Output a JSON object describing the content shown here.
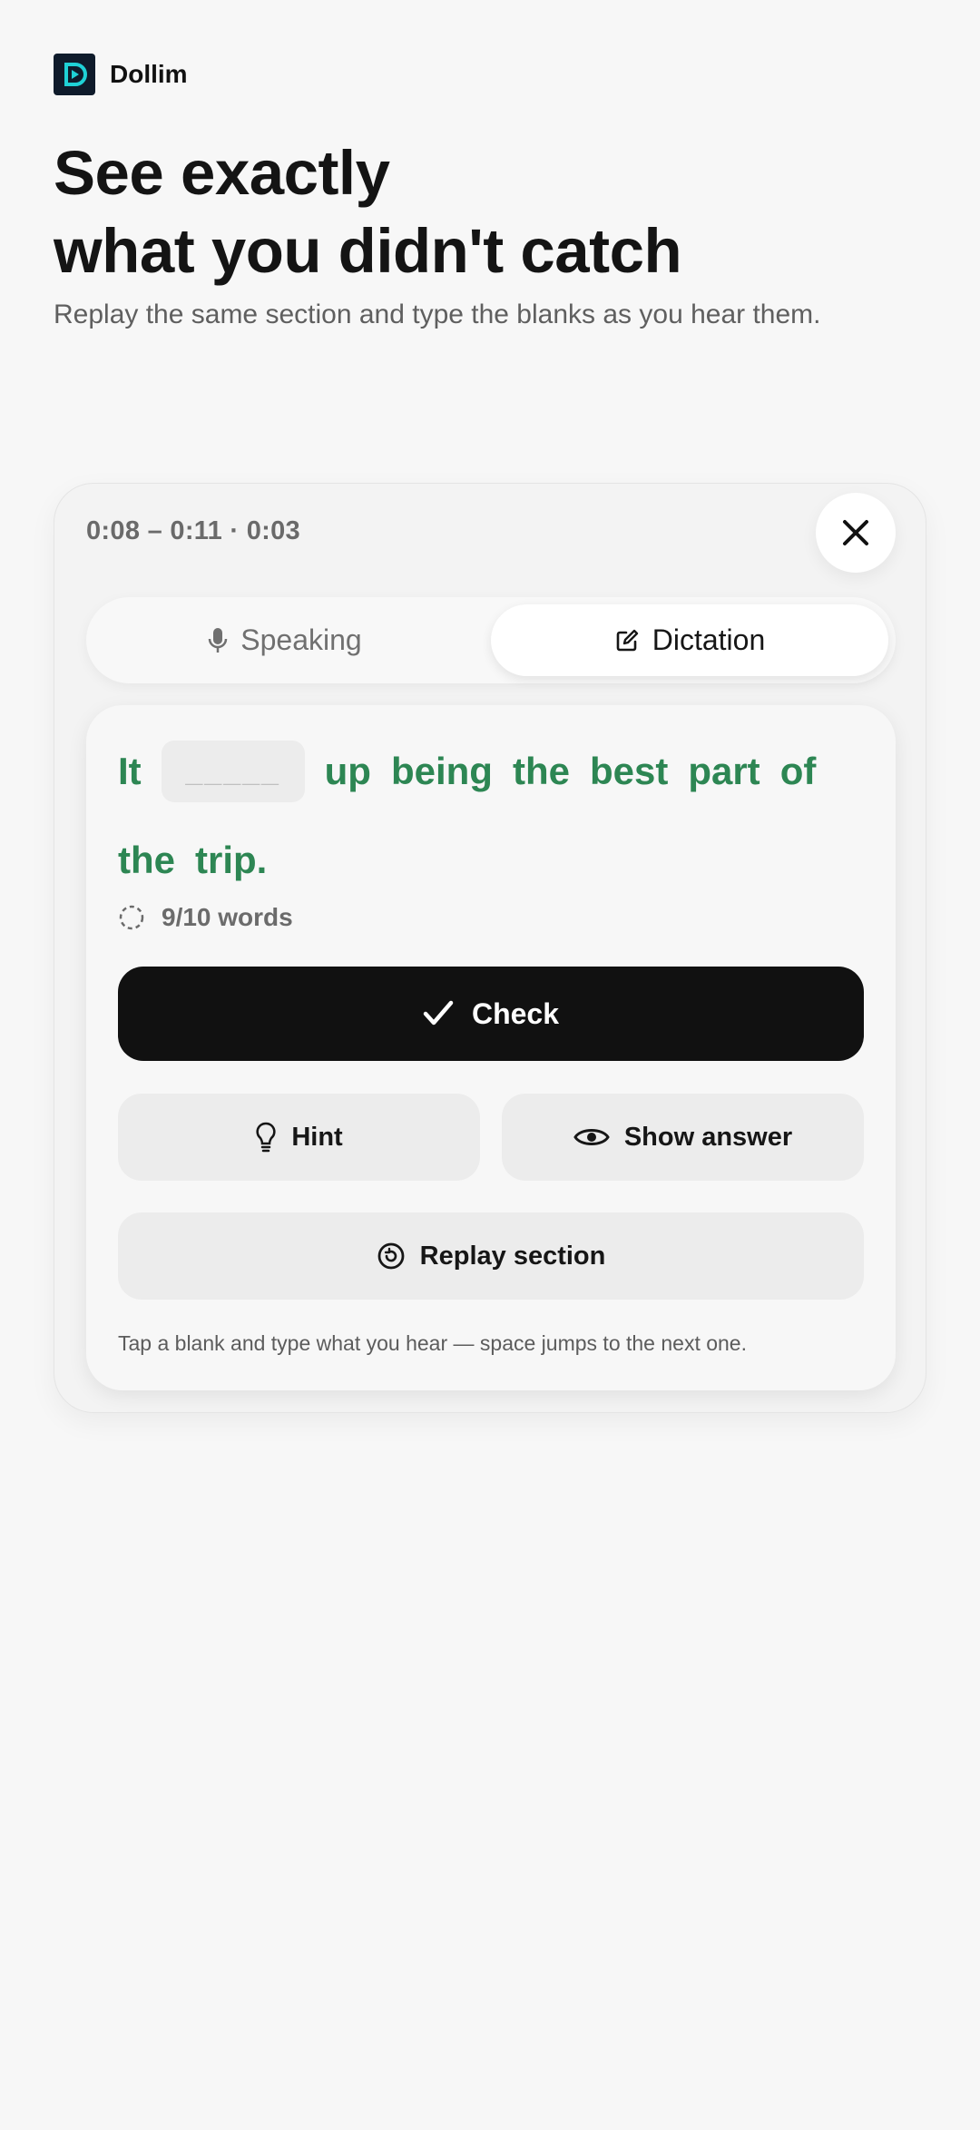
{
  "brand": {
    "name": "Dollim",
    "logo_icon": "play-logo-icon",
    "logo_color": "#1fd1d6"
  },
  "hero": {
    "title_line1": "See exactly",
    "title_line2": "what you didn't catch",
    "subtitle": "Replay the same section and type the blanks as you hear them."
  },
  "panel": {
    "time_range": "0:08 – 0:11 · 0:03",
    "tabs": [
      {
        "label": "Speaking",
        "icon": "microphone-icon",
        "active": false
      },
      {
        "label": "Dictation",
        "icon": "edit-icon",
        "active": true
      }
    ],
    "exercise": {
      "line1_before": "It",
      "blank_placeholder": "_____",
      "line1_after": [
        "up",
        "being",
        "the",
        "best",
        "part",
        "of"
      ],
      "line2": [
        "the",
        "trip."
      ],
      "progress_text": "9/10 words",
      "text_color": "#2d8653"
    },
    "buttons": {
      "check": "Check",
      "hint": "Hint",
      "show_answer": "Show answer",
      "replay": "Replay section"
    },
    "footnote": "Tap a blank and type what you hear — space jumps to the next one."
  }
}
